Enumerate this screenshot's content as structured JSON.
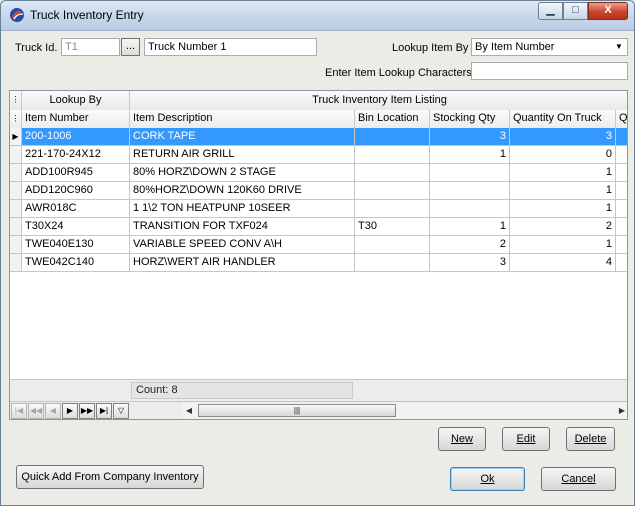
{
  "window": {
    "title": "Truck Inventory Entry"
  },
  "controls": {
    "minimize": "▁",
    "maximize": "□",
    "close": "X"
  },
  "top": {
    "truck_id_label": "Truck Id.",
    "truck_id_value": "T1",
    "browse_label": "...",
    "truck_name_value": "Truck Number 1",
    "lookup_by_label": "Lookup Item By",
    "lookup_by_value": "By Item Number",
    "lookup_chars_label": "Enter Item Lookup Characters",
    "lookup_chars_value": ""
  },
  "grid": {
    "band_lookup": "Lookup By",
    "band_listing": "Truck Inventory Item Listing",
    "columns": [
      "Item Number",
      "Item Description",
      "Bin Location",
      "Stocking Qty",
      "Quantity On Truck",
      "Q"
    ],
    "rows": [
      [
        "200-1006",
        "CORK TAPE",
        "",
        "3",
        "3"
      ],
      [
        "221-170-24X12",
        "RETURN AIR GRILL",
        "",
        "1",
        "0"
      ],
      [
        "ADD100R945",
        "80% HORZ\\DOWN 2 STAGE",
        "",
        "",
        "1"
      ],
      [
        "ADD120C960",
        "80%HORZ\\DOWN 120K60 DRIVE",
        "",
        "",
        "1"
      ],
      [
        "AWR018C",
        "1 1\\2 TON HEATPUNP 10SEER",
        "",
        "",
        "1"
      ],
      [
        "T30X24",
        "TRANSITION FOR TXF024",
        "T30",
        "1",
        "2"
      ],
      [
        "TWE040E130",
        "VARIABLE SPEED CONV A\\H",
        "",
        "2",
        "1"
      ],
      [
        "TWE042C140",
        "HORZ\\WERT AIR HANDLER",
        "",
        "3",
        "4"
      ]
    ],
    "selected_row": 0,
    "count_text": "Count: 8"
  },
  "buttons": {
    "new": "New",
    "edit": "Edit",
    "delete": "Delete",
    "quick_add": "Quick Add From Company Inventory",
    "ok": "Ok",
    "cancel": "Cancel"
  },
  "colors": {
    "selection": "#3399ff",
    "title_bar": "#c6d6ea"
  }
}
